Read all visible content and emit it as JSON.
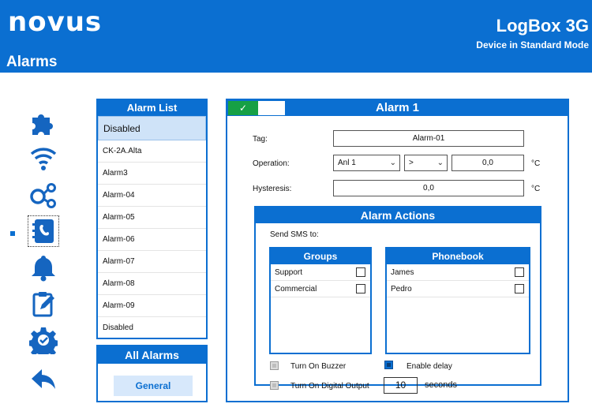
{
  "header": {
    "logo": "novus",
    "screen_title": "Alarms",
    "device_name": "LogBox 3G",
    "device_mode": "Device in Standard Mode",
    "bg_color": "#0b6fd1"
  },
  "nav": {
    "items": [
      {
        "icon": "puzzle-icon"
      },
      {
        "icon": "wifi-icon"
      },
      {
        "icon": "share-nodes-icon"
      },
      {
        "icon": "phonebook-icon",
        "selected": true
      },
      {
        "icon": "bell-icon"
      },
      {
        "icon": "clipboard-edit-icon"
      },
      {
        "icon": "gear-check-icon"
      },
      {
        "icon": "back-arrow-icon"
      }
    ]
  },
  "alarm_list": {
    "title": "Alarm  List",
    "items": [
      "Disabled",
      "CK-2A.Alta",
      "Alarm3",
      "Alarm-04",
      "Alarm-05",
      "Alarm-06",
      "Alarm-07",
      "Alarm-08",
      "Alarm-09",
      "Disabled"
    ],
    "selected_index": 0
  },
  "all_alarms": {
    "title": "All Alarms",
    "button_label": "General"
  },
  "alarm": {
    "title": "Alarm  1",
    "enabled_mark": "✓",
    "tag_label": "Tag:",
    "tag_value": "Alarm-01",
    "operation_label": "Operation:",
    "operation_channel": "Anl 1",
    "operation_operator": ">",
    "operation_value": "0,0",
    "operation_unit": "°C",
    "hysteresis_label": "Hysteresis:",
    "hysteresis_value": "0,0",
    "hysteresis_unit": "°C"
  },
  "actions": {
    "title": "Alarm Actions",
    "send_sms_label": "Send SMS to:",
    "groups": {
      "title": "Groups",
      "rows": [
        {
          "name": "Support",
          "checked": false
        },
        {
          "name": "Commercial",
          "checked": false
        }
      ]
    },
    "phonebook": {
      "title": "Phonebook",
      "rows": [
        {
          "name": "James",
          "checked": false
        },
        {
          "name": "Pedro",
          "checked": false
        }
      ]
    },
    "buzzer_label": "Turn On Buzzer",
    "digital_output_label": "Turn On Digital Output",
    "enable_delay_label": "Enable delay",
    "enable_delay_checked": true,
    "delay_value": "10",
    "delay_unit": "seconds"
  }
}
